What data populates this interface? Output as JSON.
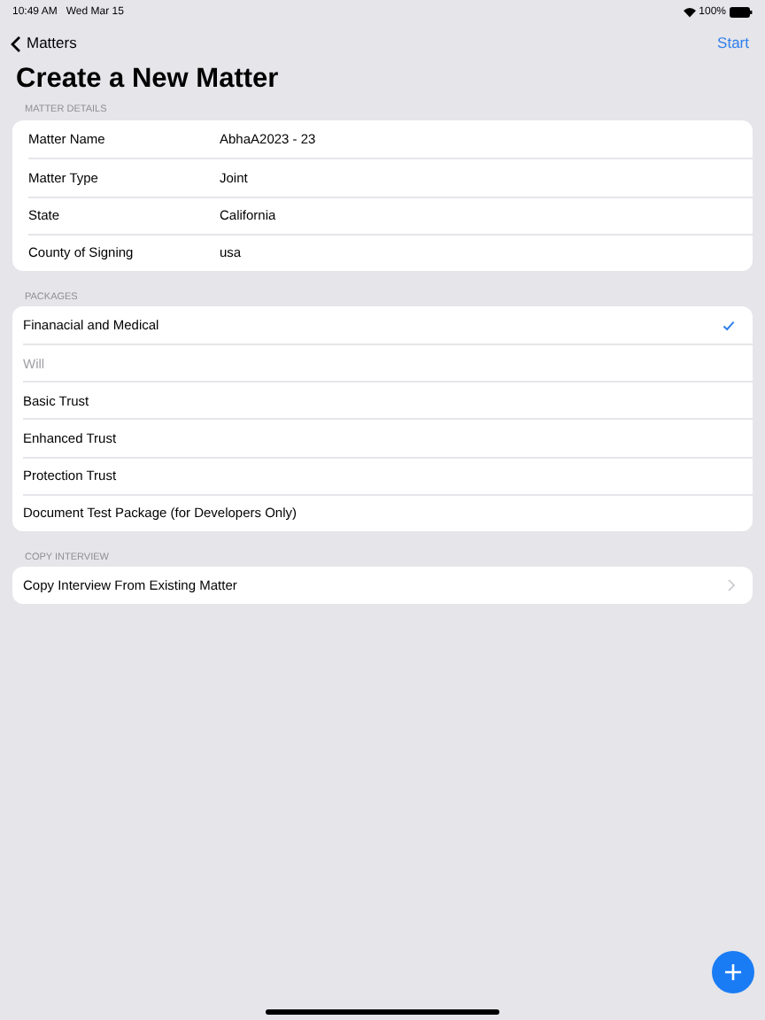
{
  "status_bar": {
    "time": "10:49 AM",
    "date": "Wed Mar 15",
    "battery": "100%"
  },
  "nav": {
    "back": "Matters",
    "action": "Start"
  },
  "title": "Create a New Matter",
  "details": {
    "header": "MATTER DETAILS",
    "rows": [
      {
        "label": "Matter Name",
        "value": "AbhaA2023 - 23"
      },
      {
        "label": "Matter Type",
        "value": "Joint"
      },
      {
        "label": "State",
        "value": "California"
      },
      {
        "label": "County of Signing",
        "value": "usa"
      }
    ]
  },
  "packages": {
    "header": "PACKAGES",
    "items": [
      {
        "label": "Finanacial and Medical",
        "selected": true,
        "disabled": false
      },
      {
        "label": "Will",
        "selected": false,
        "disabled": true
      },
      {
        "label": "Basic Trust",
        "selected": false,
        "disabled": false
      },
      {
        "label": "Enhanced Trust",
        "selected": false,
        "disabled": false
      },
      {
        "label": "Protection Trust",
        "selected": false,
        "disabled": false
      },
      {
        "label": "Document Test Package (for Developers Only)",
        "selected": false,
        "disabled": false
      }
    ]
  },
  "copy": {
    "header": "COPY INTERVIEW",
    "label": "Copy Interview From Existing Matter"
  }
}
